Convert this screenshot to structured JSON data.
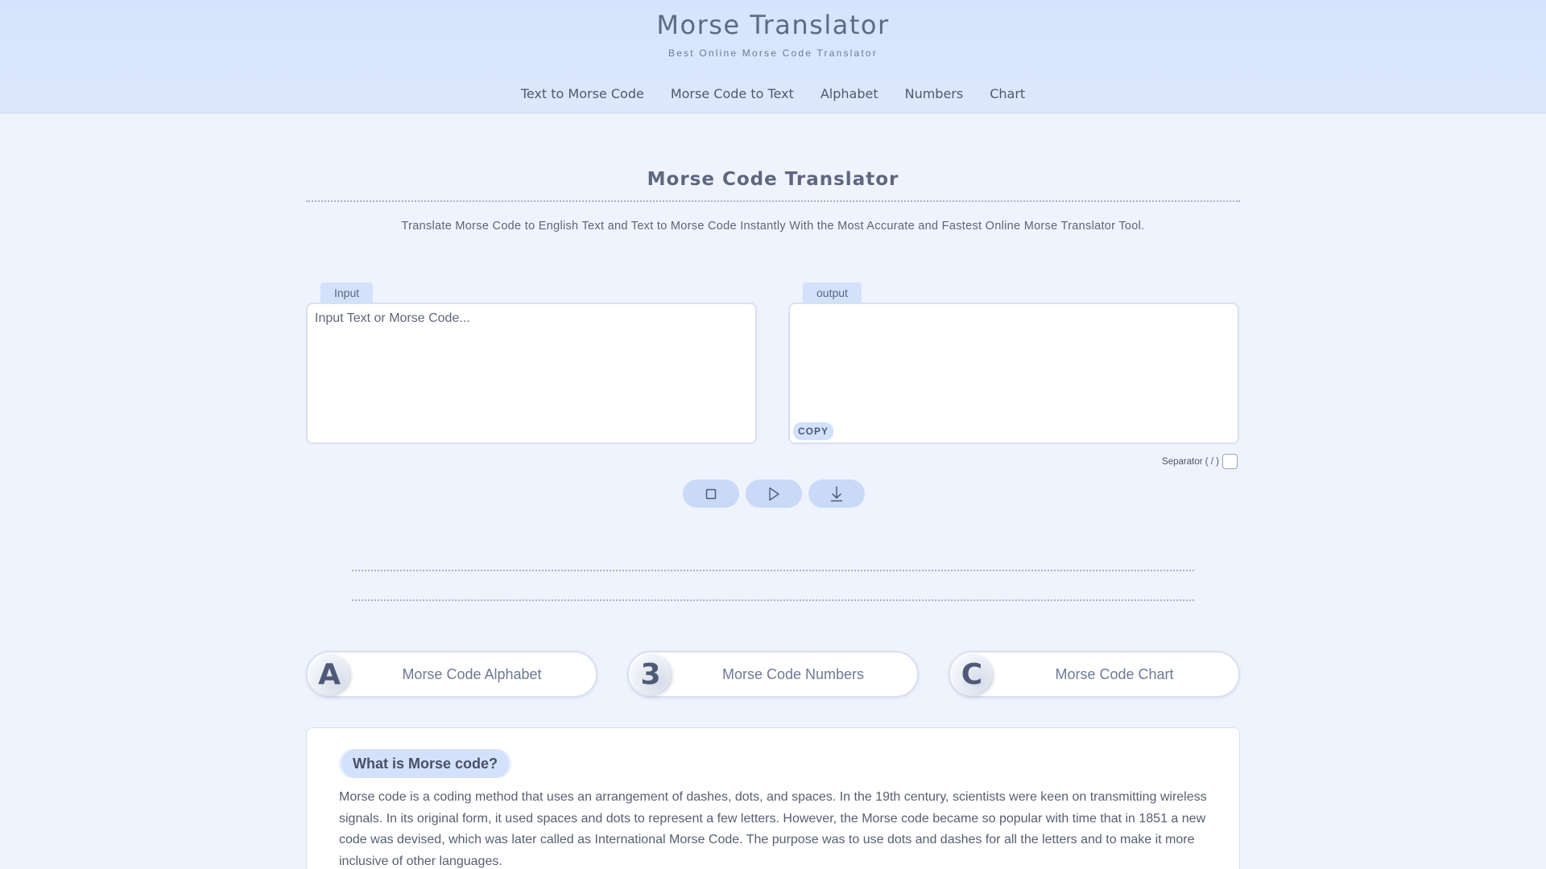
{
  "header": {
    "title": "Morse Translator",
    "subtitle": "Best Online Morse Code Translator",
    "nav": [
      "Text to Morse Code",
      "Morse Code to Text",
      "Alphabet",
      "Numbers",
      "Chart"
    ]
  },
  "main": {
    "title": "Morse Code Translator",
    "description": "Translate Morse Code to English Text and Text to Morse Code Instantly With the Most Accurate and Fastest Online Morse Translator Tool.",
    "input": {
      "tab_label": "Input",
      "placeholder": "Input Text or Morse Code...",
      "value": ""
    },
    "output": {
      "tab_label": "output",
      "value": "",
      "copy_label": "COPY"
    },
    "separator_label": "Separator ( / )",
    "separator_checked": false,
    "controls": [
      "stop-icon",
      "play-icon",
      "download-icon"
    ]
  },
  "cards": [
    {
      "badge": "A",
      "label": "Morse Code Alphabet"
    },
    {
      "badge": "3",
      "label": "Morse Code Numbers"
    },
    {
      "badge": "C",
      "label": "Morse Code Chart"
    }
  ],
  "info": {
    "heading": "What is Morse code?",
    "body": "Morse code is a coding method that uses an arrangement of dashes, dots, and spaces. In the 19th century, scientists were keen on transmitting wireless signals. In its original form, it used spaces and dots to represent a few letters. However, the Morse code became so popular with time that in 1851 a new code was devised, which was later called as International Morse Code. The purpose was to use dots and dashes for all the letters and to make it more inclusive of other languages."
  },
  "colors": {
    "header_bg": "#d5e3fc",
    "page_bg": "#eef3fd",
    "accent": "#d4e1fb",
    "button": "#c9daf8",
    "text": "#5b6479"
  }
}
